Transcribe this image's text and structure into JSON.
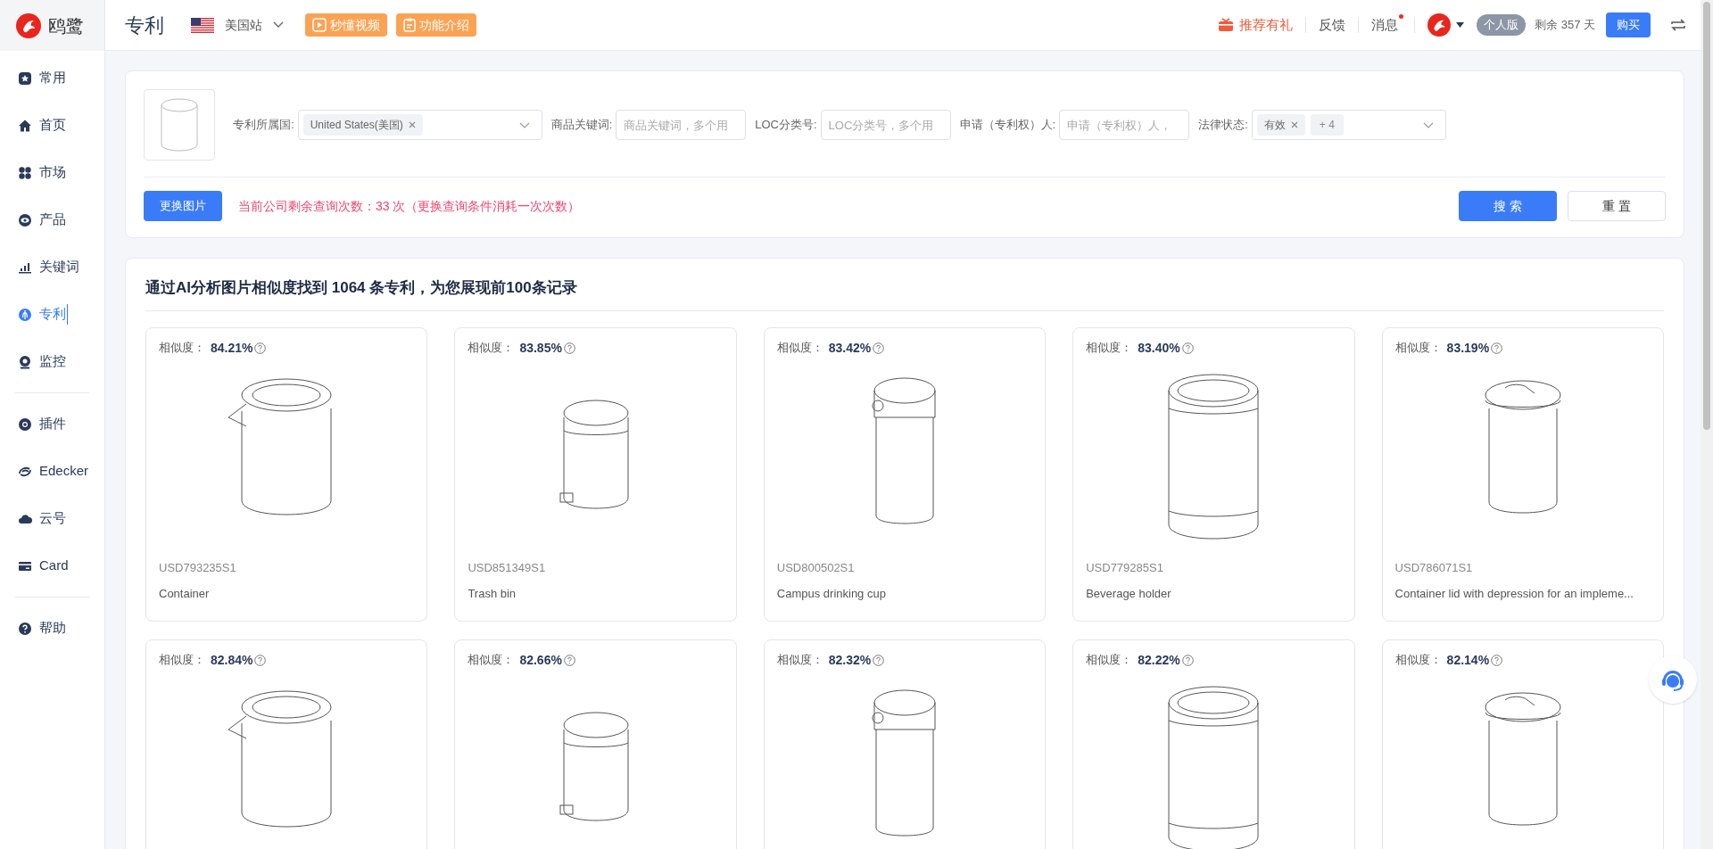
{
  "sidebar": {
    "logo_text": "鸥鹭",
    "groups": [
      [
        {
          "label": "常用",
          "selected": false
        },
        {
          "label": "首页",
          "selected": false
        },
        {
          "label": "市场",
          "selected": false
        },
        {
          "label": "产品",
          "selected": false
        },
        {
          "label": "关键词",
          "selected": false
        },
        {
          "label": "专利",
          "selected": true
        },
        {
          "label": "监控",
          "selected": false
        }
      ],
      [
        {
          "label": "插件",
          "selected": false
        },
        {
          "label": "Edecker",
          "selected": false
        },
        {
          "label": "云号",
          "selected": false
        },
        {
          "label": "Card",
          "selected": false
        }
      ],
      [
        {
          "label": "帮助",
          "selected": false
        }
      ]
    ]
  },
  "topbar": {
    "title": "专利",
    "site": "美国站",
    "buttons": [
      {
        "label": "秒懂视频"
      },
      {
        "label": "功能介绍"
      }
    ],
    "referral": "推荐有礼",
    "feedback": "反馈",
    "messages": {
      "label": "消息",
      "unread": true
    },
    "plan": "个人版",
    "remaining": "剩余 357 天",
    "buy": "购买"
  },
  "filters": {
    "fields": [
      {
        "kind": "select",
        "label": "专利所属国:",
        "tags": [
          "United States(美国)"
        ]
      },
      {
        "kind": "input",
        "label": "商品关键词:",
        "placeholder": "商品关键词，多个用"
      },
      {
        "kind": "input",
        "label": "LOC分类号:",
        "placeholder": "LOC分类号，多个用"
      },
      {
        "kind": "input",
        "label": "申请（专利权）人:",
        "placeholder": "申请（专利权）人，"
      },
      {
        "kind": "select",
        "label": "法律状态:",
        "tags": [
          "有效"
        ],
        "more": "+ 4"
      }
    ],
    "change_image": "更换图片",
    "quota": "当前公司剩余查询次数：33 次（更换查询条件消耗一次次数）",
    "search": "搜 索",
    "reset": "重 置"
  },
  "results": {
    "heading": "通过AI分析图片相似度找到 1064 条专利，为您展现前100条记录",
    "cards": [
      {
        "similarity_label": "相似度：",
        "similarity": "84.21%",
        "number": "USD793235S1",
        "title": "Container"
      },
      {
        "similarity_label": "相似度：",
        "similarity": "83.85%",
        "number": "USD851349S1",
        "title": "Trash bin"
      },
      {
        "similarity_label": "相似度：",
        "similarity": "83.42%",
        "number": "USD800502S1",
        "title": "Campus drinking cup"
      },
      {
        "similarity_label": "相似度：",
        "similarity": "83.40%",
        "number": "USD779285S1",
        "title": "Beverage holder"
      },
      {
        "similarity_label": "相似度：",
        "similarity": "83.19%",
        "number": "USD786071S1",
        "title": "Container lid with depression for an impleme..."
      },
      {
        "similarity_label": "相似度：",
        "similarity": "82.84%"
      },
      {
        "similarity_label": "相似度：",
        "similarity": "82.66%"
      },
      {
        "similarity_label": "相似度：",
        "similarity": "82.32%"
      },
      {
        "similarity_label": "相似度：",
        "similarity": "82.22%"
      },
      {
        "similarity_label": "相似度：",
        "similarity": "82.14%"
      }
    ]
  }
}
